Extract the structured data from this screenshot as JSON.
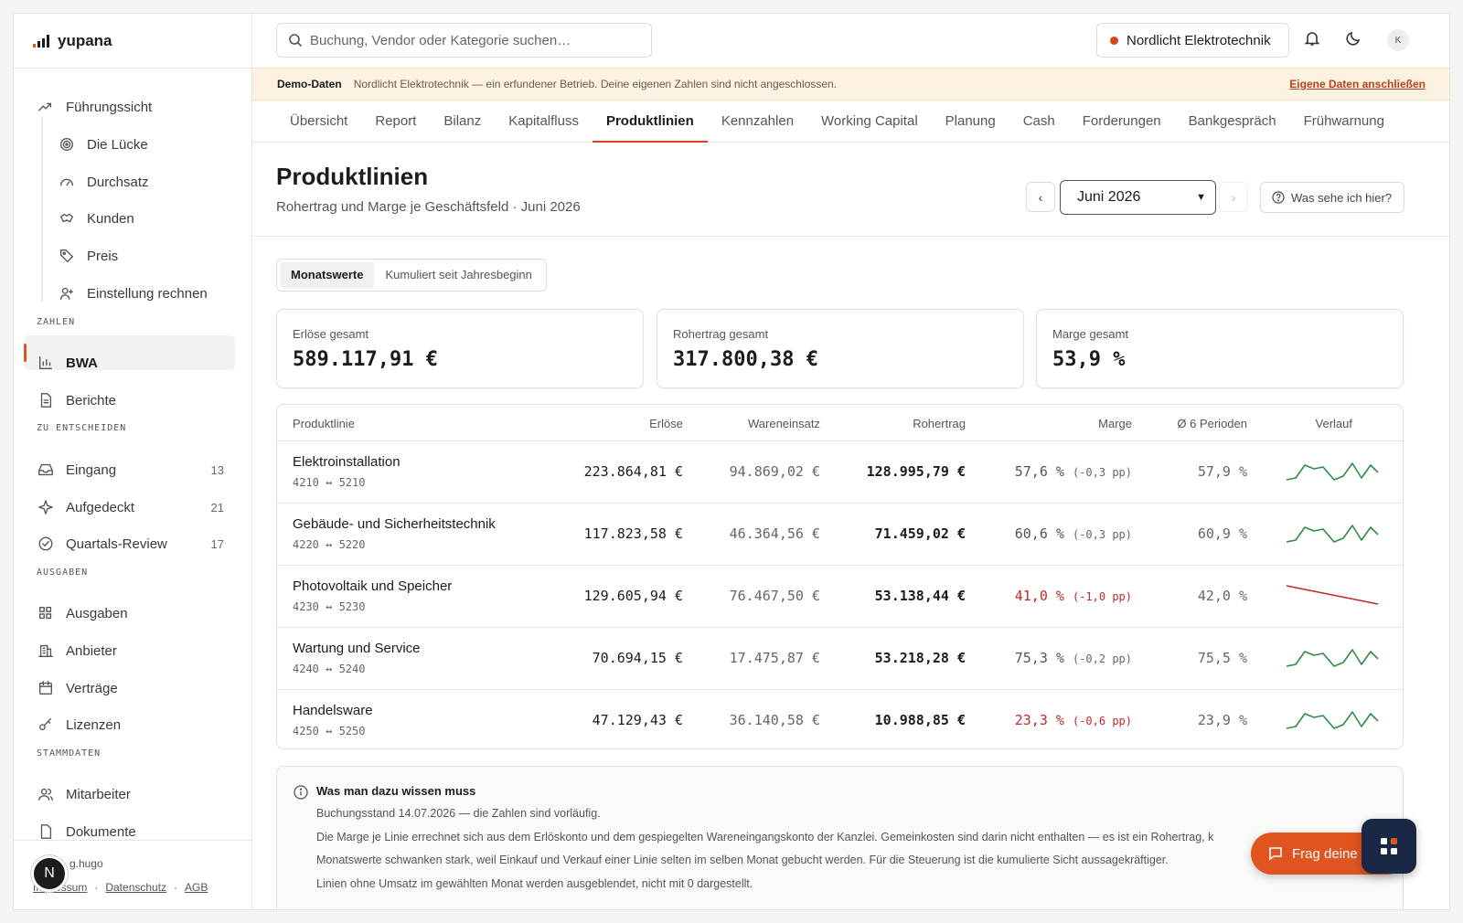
{
  "app": {
    "name": "yupana"
  },
  "sidebar": {
    "top_items": [
      {
        "label": "Führungssicht",
        "icon": "trending-icon"
      },
      {
        "label": "Die Lücke",
        "icon": "target-icon"
      },
      {
        "label": "Durchsatz",
        "icon": "gauge-icon"
      },
      {
        "label": "Kunden",
        "icon": "handshake-icon"
      },
      {
        "label": "Preis",
        "icon": "tag-icon"
      },
      {
        "label": "Einstellung rechnen",
        "icon": "user-plus-icon"
      }
    ],
    "sections": {
      "zahlen": "ZAHLEN",
      "entscheiden": "ZU ENTSCHEIDEN",
      "ausgaben": "AUSGABEN",
      "stammdaten": "STAMMDATEN"
    },
    "zahlen_items": [
      {
        "label": "BWA",
        "icon": "bar-chart-icon",
        "active": true
      },
      {
        "label": "Berichte",
        "icon": "document-icon"
      }
    ],
    "entscheiden_items": [
      {
        "label": "Eingang",
        "count": "13",
        "icon": "inbox-icon"
      },
      {
        "label": "Aufgedeckt",
        "count": "21",
        "icon": "sparkle-icon"
      },
      {
        "label": "Quartals-Review",
        "count": "17",
        "icon": "check-circle-icon"
      }
    ],
    "ausgaben_items": [
      {
        "label": "Ausgaben",
        "icon": "grid-icon"
      },
      {
        "label": "Anbieter",
        "icon": "building-icon"
      },
      {
        "label": "Verträge",
        "icon": "calendar-icon"
      },
      {
        "label": "Lizenzen",
        "icon": "key-icon"
      }
    ],
    "stammdaten_items": [
      {
        "label": "Mitarbeiter",
        "icon": "users-icon"
      },
      {
        "label": "Dokumente",
        "icon": "file-icon"
      }
    ],
    "footer": {
      "user": "g.hugo",
      "avatar_letter": "N",
      "links": [
        "Impressum",
        "Datenschutz",
        "AGB"
      ]
    }
  },
  "topbar": {
    "search_placeholder": "Buchung, Vendor oder Kategorie suchen…",
    "company": "Nordlicht Elektrotechnik",
    "user_initial": "K"
  },
  "banner": {
    "label": "Demo-Daten",
    "text": "Nordlicht Elektrotechnik — ein erfundener Betrieb. Deine eigenen Zahlen sind nicht angeschlossen.",
    "link": "Eigene Daten anschließen"
  },
  "tabs": [
    "Übersicht",
    "Report",
    "Bilanz",
    "Kapitalfluss",
    "Produktlinien",
    "Kennzahlen",
    "Working Capital",
    "Planung",
    "Cash",
    "Forderungen",
    "Bankgespräch",
    "Frühwarnung"
  ],
  "active_tab": "Produktlinien",
  "page": {
    "title": "Produktlinien",
    "subtitle": "Rohertrag und Marge je Geschäftsfeld · Juni 2026",
    "month": "Juni 2026",
    "help": "Was sehe ich hier?"
  },
  "toggle": {
    "monthly": "Monatswerte",
    "cumulative": "Kumuliert seit Jahresbeginn"
  },
  "kpis": [
    {
      "label": "Erlöse gesamt",
      "value": "589.117,91 €"
    },
    {
      "label": "Rohertrag gesamt",
      "value": "317.800,38 €"
    },
    {
      "label": "Marge gesamt",
      "value": "53,9 %"
    }
  ],
  "table": {
    "headers": {
      "line": "Produktlinie",
      "revenue": "Erlöse",
      "cogs": "Wareneinsatz",
      "gross": "Rohertrag",
      "margin": "Marge",
      "avg": "Ø 6 Perioden",
      "trend": "Verlauf"
    },
    "rows": [
      {
        "name": "Elektroinstallation",
        "accounts": "4210 ↔ 5210",
        "revenue": "223.864,81 €",
        "cogs": "94.869,02 €",
        "gross": "128.995,79 €",
        "margin": "57,6 %",
        "delta": "(-0,3 pp)",
        "avg": "57,9 %",
        "alert": false,
        "trend": "wave"
      },
      {
        "name": "Gebäude- und Sicherheitstechnik",
        "accounts": "4220 ↔ 5220",
        "revenue": "117.823,58 €",
        "cogs": "46.364,56 €",
        "gross": "71.459,02 €",
        "margin": "60,6 %",
        "delta": "(-0,3 pp)",
        "avg": "60,9 %",
        "alert": false,
        "trend": "wave"
      },
      {
        "name": "Photovoltaik und Speicher",
        "accounts": "4230 ↔ 5230",
        "revenue": "129.605,94 €",
        "cogs": "76.467,50 €",
        "gross": "53.138,44 €",
        "margin": "41,0 %",
        "delta": "(-1,0 pp)",
        "avg": "42,0 %",
        "alert": true,
        "trend": "down"
      },
      {
        "name": "Wartung und Service",
        "accounts": "4240 ↔ 5240",
        "revenue": "70.694,15 €",
        "cogs": "17.475,87 €",
        "gross": "53.218,28 €",
        "margin": "75,3 %",
        "delta": "(-0,2 pp)",
        "avg": "75,5 %",
        "alert": false,
        "trend": "wave"
      },
      {
        "name": "Handelsware",
        "accounts": "4250 ↔ 5250",
        "revenue": "47.129,43 €",
        "cogs": "36.140,58 €",
        "gross": "10.988,85 €",
        "margin": "23,3 %",
        "delta": "(-0,6 pp)",
        "avg": "23,9 %",
        "alert": true,
        "trend": "wave"
      }
    ]
  },
  "info": {
    "title": "Was man dazu wissen muss",
    "lines": [
      "Buchungsstand 14.07.2026 — die Zahlen sind vorläufig.",
      "Die Marge je Linie errechnet sich aus dem Erlöskonto und dem gespiegelten Wareneingangskonto der Kanzlei. Gemeinkosten sind darin nicht enthalten — es ist ein Rohertrag, k",
      "Monatswerte schwanken stark, weil Einkauf und Verkauf einer Linie selten im selben Monat gebucht werden. Für die Steuerung ist die kumulierte Sicht aussagekräftiger.",
      "Linien ohne Umsatz im gewählten Monat werden ausgeblendet, nicht mit 0 dargestellt."
    ]
  },
  "fab": {
    "label": "Frag deine"
  },
  "colors": {
    "accent": "#e0541f",
    "positive": "#2e8b47",
    "negative": "#c02a2a",
    "banner": "#fdf1e1"
  }
}
